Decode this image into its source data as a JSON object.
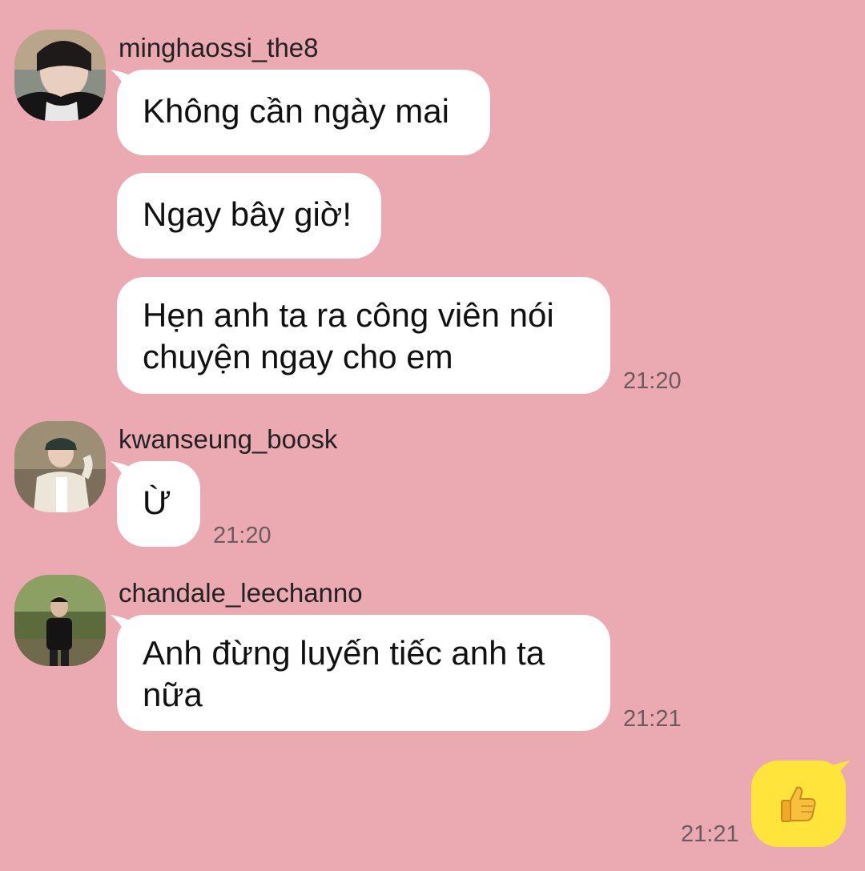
{
  "messages": [
    {
      "sender": "minghaossi_the8",
      "bubbles": [
        "Không cần ngày mai",
        "Ngay bây giờ!",
        "Hẹn anh ta ra công viên nói chuyện ngay cho em"
      ],
      "time": "21:20"
    },
    {
      "sender": "kwanseung_boosk",
      "bubbles": [
        "Ừ"
      ],
      "time": "21:20"
    },
    {
      "sender": "chandale_leechanno",
      "bubbles": [
        "Anh đừng luyến tiếc anh ta nữa"
      ],
      "time": "21:21"
    }
  ],
  "my_message": {
    "sticker": "thumbs-up-icon",
    "time": "21:21"
  },
  "colors": {
    "background": "#eba9b2",
    "incoming_bubble": "#ffffff",
    "outgoing_bubble": "#ffe53b",
    "time_text": "#6c5a5e"
  }
}
